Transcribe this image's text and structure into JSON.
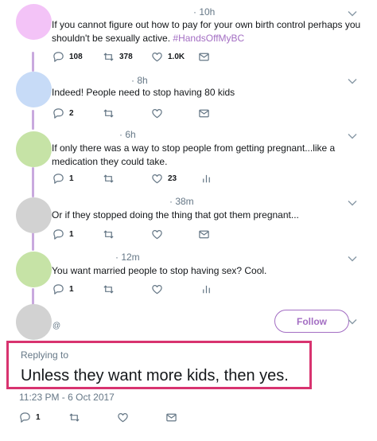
{
  "tweets": [
    {
      "time": "· 10h",
      "avatar_color": "#f3c3f7",
      "text_before": "If you cannot figure out how to pay for your own birth control perhaps you shouldn't be sexually active.",
      "hashtag": "#HandsOffMyBC",
      "reply_count": "108",
      "retweet_count": "378",
      "like_count": "1.0K"
    },
    {
      "time": "· 8h",
      "avatar_color": "#c7dbf7",
      "text": "Indeed! People need to stop having 80 kids",
      "reply_count": "2"
    },
    {
      "time": "· 6h",
      "avatar_color": "#c6e3a6",
      "text": "If only there was a way to stop people from getting pregnant...like a medication they could take.",
      "reply_count": "1",
      "like_count": "23"
    },
    {
      "time": "· 38m",
      "avatar_color": "#d2d2d2",
      "text": "Or if they stopped doing the thing that got them pregnant...",
      "reply_count": "1"
    },
    {
      "time": "· 12m",
      "avatar_color": "#c6e3a6",
      "text": "You want married people to stop having sex? Cool.",
      "reply_count": "1"
    }
  ],
  "focused": {
    "avatar_color": "#d2d2d2",
    "handle": "@",
    "follow_label": "Follow",
    "replying_to_label": "Replying to",
    "text": "Unless they want more kids, then yes.",
    "timestamp": "11:23 PM - 6 Oct 2017",
    "reply_count": "1"
  },
  "colors": {
    "accent": "#a36ec3",
    "highlight_border": "#d8336f",
    "thread_line": "#c9a9de",
    "icon_gray": "#657786"
  }
}
